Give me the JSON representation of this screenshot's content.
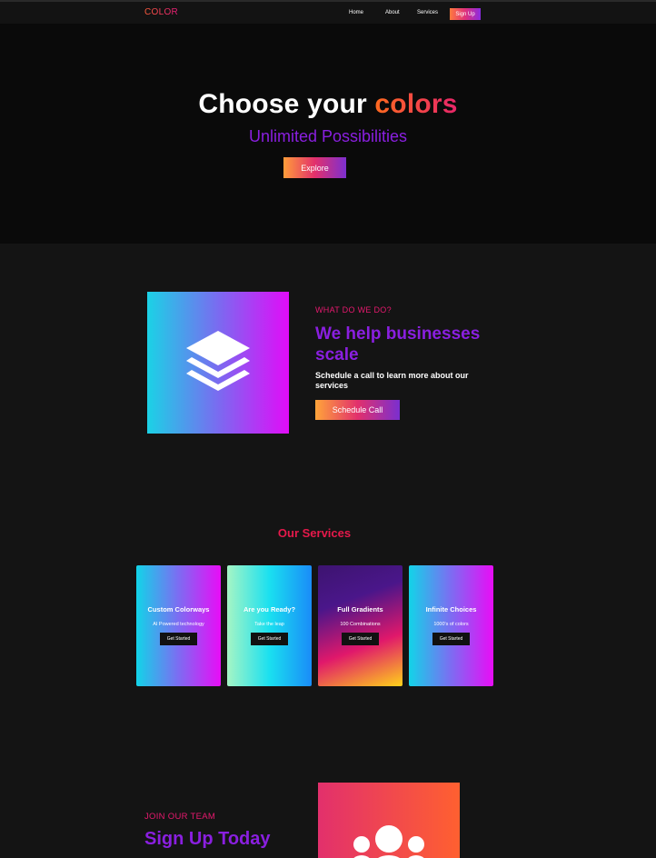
{
  "nav": {
    "logo": "COLOR",
    "links": [
      "Home",
      "About",
      "Services"
    ],
    "signup": "Sign Up"
  },
  "hero": {
    "title_main": "Choose your ",
    "title_accent": "colors",
    "subtitle": "Unlimited Possibilities",
    "button": "Explore"
  },
  "about": {
    "eyebrow": "WHAT DO WE DO?",
    "title": "We help businesses scale",
    "description": "Schedule a call to learn more about our services",
    "button": "Schedule Call",
    "icon": "layers-icon"
  },
  "services": {
    "heading": "Our Services",
    "cards": [
      {
        "title": "Custom Colorways",
        "subtitle": "AI Powered technology",
        "button": "Get Started"
      },
      {
        "title": "Are you Ready?",
        "subtitle": "Take the leap",
        "button": "Get Started"
      },
      {
        "title": "Full Gradients",
        "subtitle": "100 Combinations",
        "button": "Get Started"
      },
      {
        "title": "Infinite Choices",
        "subtitle": "1000's of colors",
        "button": "Get Started"
      }
    ]
  },
  "join": {
    "eyebrow": "JOIN OUR TEAM",
    "title": "Sign Up Today",
    "icon": "users-icon"
  },
  "colors": {
    "background": "#141414",
    "hero_background": "#0a0a0a",
    "accent_purple": "#8a1fe0",
    "accent_pink": "#e6196e",
    "accent_orange": "#ff6a1f"
  }
}
